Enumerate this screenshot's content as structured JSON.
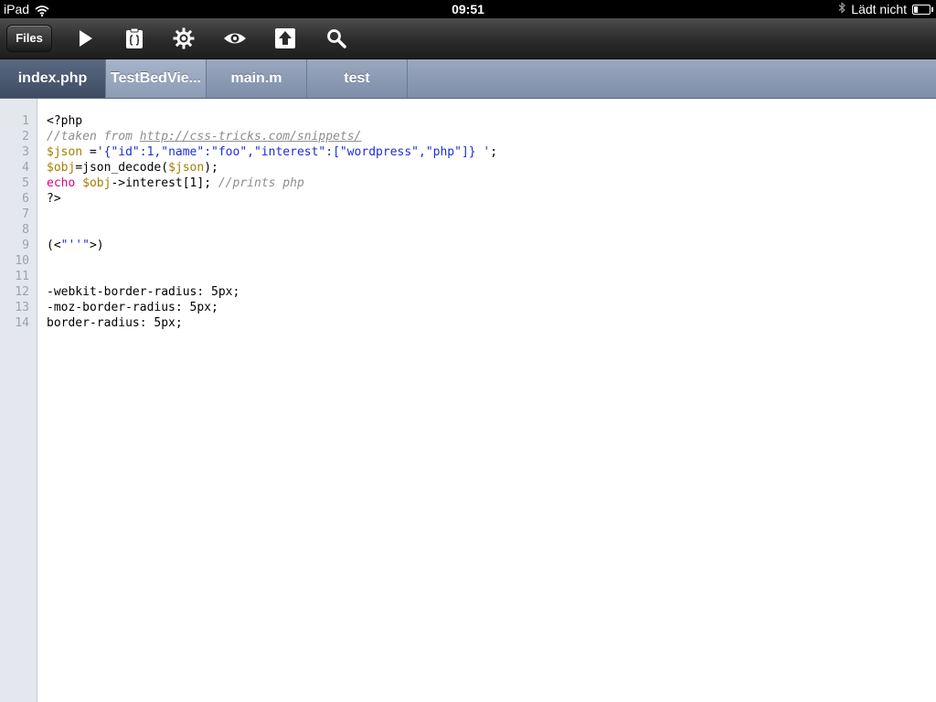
{
  "status_bar": {
    "device": "iPad",
    "time": "09:51",
    "charge_text": "Lädt nicht",
    "battery_level": 0.25
  },
  "toolbar": {
    "files_label": "Files",
    "icons": [
      "play-icon",
      "clipboard-braces-icon",
      "gear-icon",
      "eye-icon",
      "upload-icon",
      "search-icon"
    ]
  },
  "tabs": [
    {
      "label": "index.php",
      "active": true
    },
    {
      "label": "TestBedVie...",
      "active": false
    },
    {
      "label": "main.m",
      "active": false
    },
    {
      "label": "test",
      "active": false
    }
  ],
  "editor": {
    "line_numbers": [
      "1",
      "2",
      "3",
      "4",
      "5",
      "6",
      "7",
      "8",
      "9",
      "10",
      "11",
      "12",
      "13",
      "14"
    ],
    "lines": [
      "<?php",
      "//taken from http://css-tricks.com/snippets/",
      "$json ='{\"id\":1,\"name\":\"foo\",\"interest\":[\"wordpress\",\"php\"]} ';",
      "$obj=json_decode($json);",
      "echo $obj->interest[1]; //prints php",
      "?>",
      "",
      "",
      "(<\"''\">)",
      "",
      "",
      "-webkit-border-radius: 5px;",
      "-moz-border-radius: 5px;",
      "border-radius: 5px;"
    ]
  }
}
